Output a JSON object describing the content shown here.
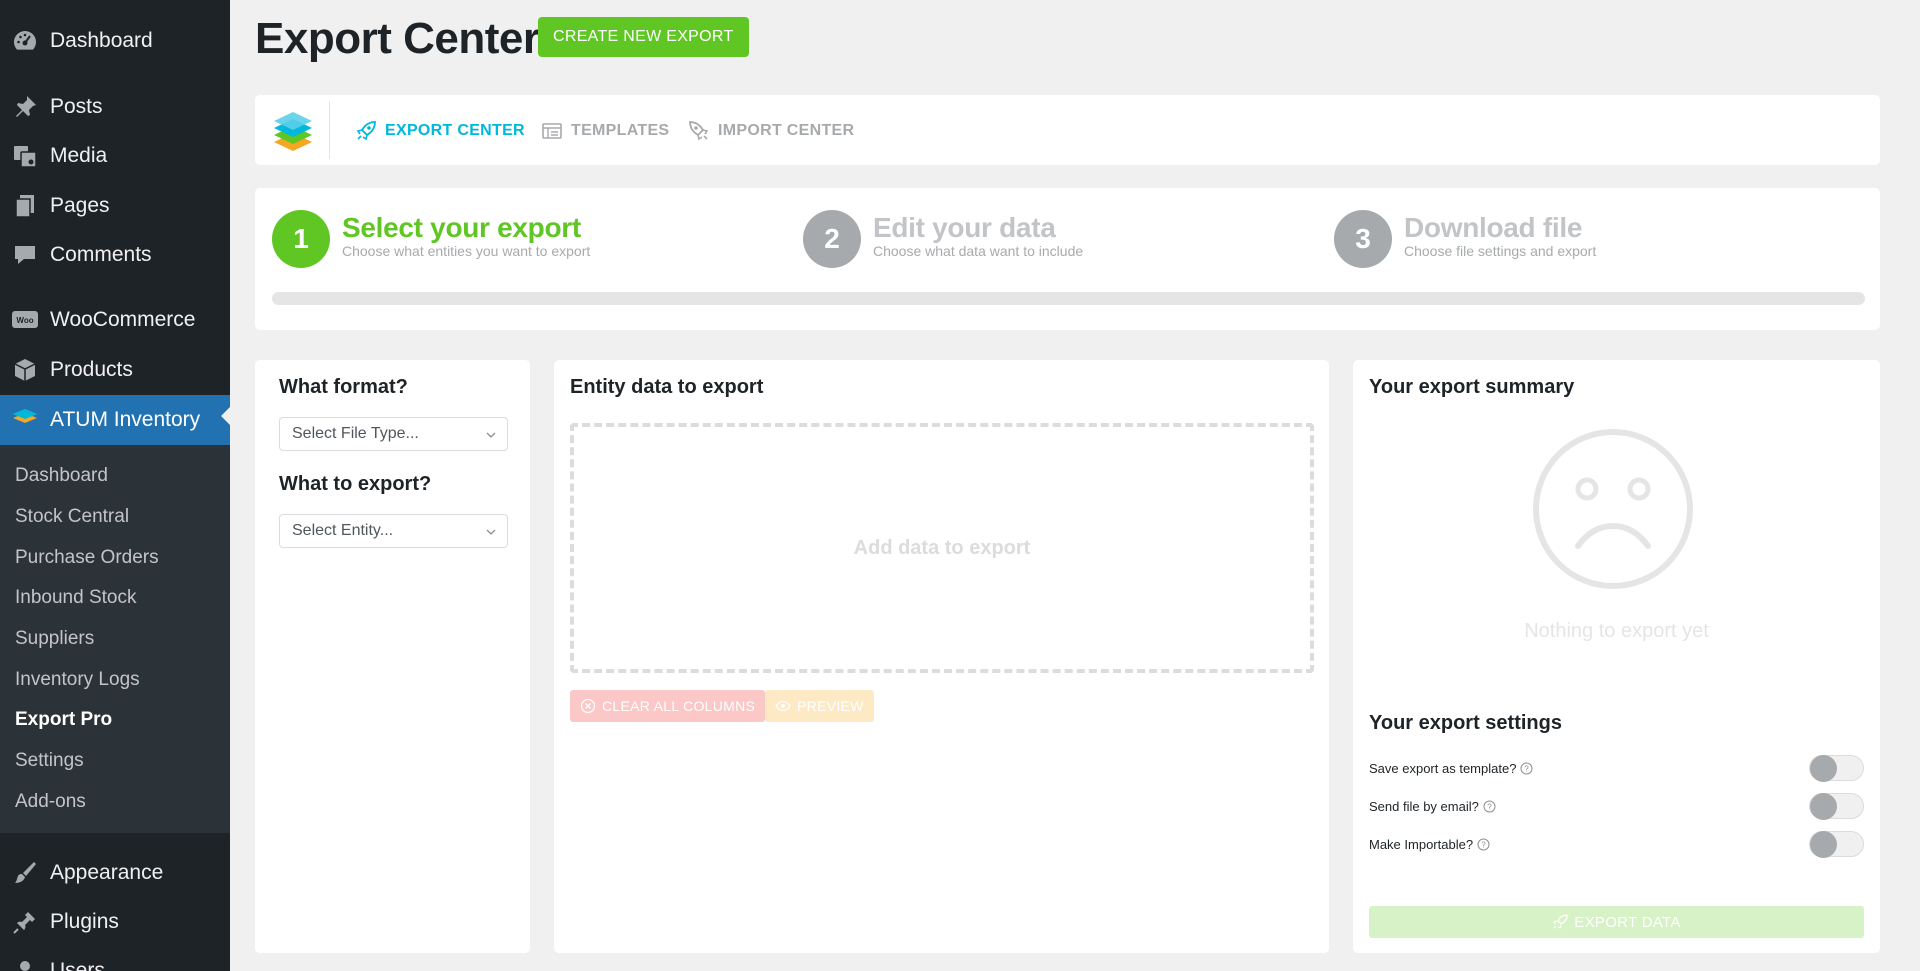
{
  "sidebar": {
    "menu": [
      {
        "label": "Dashboard",
        "icon": "dashboard-icon"
      },
      {
        "label": "Posts",
        "icon": "pin-icon"
      },
      {
        "label": "Media",
        "icon": "media-icon"
      },
      {
        "label": "Pages",
        "icon": "pages-icon"
      },
      {
        "label": "Comments",
        "icon": "comment-icon"
      },
      {
        "label": "WooCommerce",
        "icon": "woo-icon"
      },
      {
        "label": "Products",
        "icon": "box-icon"
      },
      {
        "label": "ATUM Inventory",
        "icon": "atum-icon"
      },
      {
        "label": "Appearance",
        "icon": "brush-icon"
      },
      {
        "label": "Plugins",
        "icon": "plug-icon"
      },
      {
        "label": "Users",
        "icon": "user-icon"
      }
    ],
    "submenu": [
      "Dashboard",
      "Stock Central",
      "Purchase Orders",
      "Inbound Stock",
      "Suppliers",
      "Inventory Logs",
      "Export Pro",
      "Settings",
      "Add-ons"
    ],
    "current_submenu": "Export Pro"
  },
  "header": {
    "title": "Export Center",
    "create_button": "CREATE NEW EXPORT"
  },
  "nav": {
    "tabs": [
      {
        "label": "EXPORT CENTER",
        "icon": "rocket-icon",
        "active": true
      },
      {
        "label": "TEMPLATES",
        "icon": "template-icon",
        "active": false
      },
      {
        "label": "IMPORT CENTER",
        "icon": "import-rocket-icon",
        "active": false
      }
    ]
  },
  "steps": {
    "items": [
      {
        "number": "1",
        "title": "Select your export",
        "subtitle": "Choose what entities you want to export",
        "active": true
      },
      {
        "number": "2",
        "title": "Edit your data",
        "subtitle": "Choose what data want to include",
        "active": false
      },
      {
        "number": "3",
        "title": "Download file",
        "subtitle": "Choose file settings and export",
        "active": false
      }
    ],
    "progress": 0
  },
  "left_panel": {
    "format_heading": "What format?",
    "format_placeholder": "Select File Type...",
    "entity_heading": "What to export?",
    "entity_placeholder": "Select Entity..."
  },
  "middle_panel": {
    "heading": "Entity data to export",
    "dropzone_text": "Add data to export",
    "clear_button": "CLEAR ALL COLUMNS",
    "preview_button": "PREVIEW"
  },
  "right_panel": {
    "summary_heading": "Your export summary",
    "empty_text": "Nothing to export yet",
    "settings_heading": "Your export settings",
    "settings": [
      {
        "label": "Save export as template?",
        "enabled": false
      },
      {
        "label": "Send file by email?",
        "enabled": false
      },
      {
        "label": "Make Importable?",
        "enabled": false
      }
    ],
    "export_button": "EXPORT DATA"
  },
  "colors": {
    "green": "#5fc623",
    "cyan": "#00b8db",
    "wp_blue": "#2271b1",
    "sidebar": "#1d2327"
  }
}
